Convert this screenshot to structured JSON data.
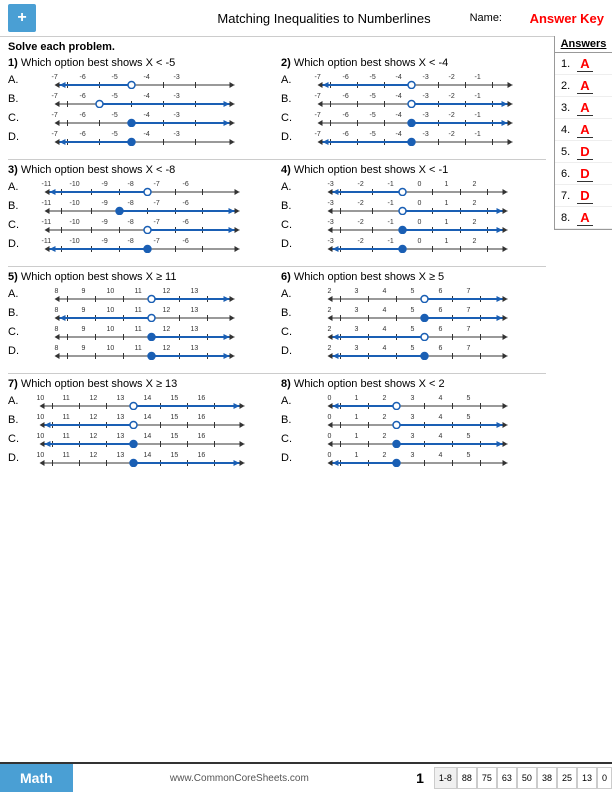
{
  "header": {
    "title": "Matching Inequalities to Numberlines",
    "name_label": "Name:",
    "answer_key": "Answer Key",
    "logo": "+"
  },
  "instructions": "Solve each problem.",
  "answers_panel": {
    "title": "Answers",
    "items": [
      {
        "num": "1.",
        "val": "A"
      },
      {
        "num": "2.",
        "val": "A"
      },
      {
        "num": "3.",
        "val": "A"
      },
      {
        "num": "4.",
        "val": "A"
      },
      {
        "num": "5.",
        "val": "D"
      },
      {
        "num": "6.",
        "val": "D"
      },
      {
        "num": "7.",
        "val": "D"
      },
      {
        "num": "8.",
        "val": "A"
      }
    ]
  },
  "problems": [
    {
      "num": "1)",
      "question": "Which option best shows X < -5",
      "labels": [
        "-7",
        "-6",
        "-5",
        "-4",
        "-3"
      ],
      "options": [
        "A",
        "B",
        "C",
        "D"
      ],
      "correct": "A"
    },
    {
      "num": "2)",
      "question": "Which option best shows X < -4",
      "labels": [
        "-7",
        "-6",
        "-5",
        "-4",
        "-3",
        "-2",
        "-1"
      ],
      "options": [
        "A",
        "B",
        "C",
        "D"
      ],
      "correct": "A"
    },
    {
      "num": "3)",
      "question": "Which option best shows X < -8",
      "labels": [
        "-11",
        "-10",
        "-9",
        "-8",
        "-7",
        "-6"
      ],
      "options": [
        "A",
        "B",
        "C",
        "D"
      ],
      "correct": "A"
    },
    {
      "num": "4)",
      "question": "Which option best shows X < -1",
      "labels": [
        "-3",
        "-2",
        "-1",
        "0",
        "1",
        "2"
      ],
      "options": [
        "A",
        "B",
        "C",
        "D"
      ],
      "correct": "A"
    },
    {
      "num": "5)",
      "question": "Which option best shows X ≥ 11",
      "labels": [
        "8",
        "9",
        "10",
        "11",
        "12",
        "13"
      ],
      "options": [
        "A",
        "B",
        "C",
        "D"
      ],
      "correct": "D"
    },
    {
      "num": "6)",
      "question": "Which option best shows X ≥ 5",
      "labels": [
        "2",
        "3",
        "4",
        "5",
        "6",
        "7"
      ],
      "options": [
        "A",
        "B",
        "C",
        "D"
      ],
      "correct": "D"
    },
    {
      "num": "7)",
      "question": "Which option best shows X ≥ 13",
      "labels": [
        "10",
        "11",
        "12",
        "13",
        "14",
        "15",
        "16"
      ],
      "options": [
        "A",
        "B",
        "C",
        "D"
      ],
      "correct": "D"
    },
    {
      "num": "8)",
      "question": "Which option best shows X < 2",
      "labels": [
        "0",
        "1",
        "2",
        "3",
        "4",
        "5"
      ],
      "options": [
        "A",
        "B",
        "C",
        "D"
      ],
      "correct": "A"
    }
  ],
  "footer": {
    "math_label": "Math",
    "url": "www.CommonCoreSheets.com",
    "page": "1",
    "range": "1-8",
    "scores": [
      "88",
      "75",
      "63",
      "50",
      "38",
      "25",
      "13",
      "0"
    ]
  }
}
